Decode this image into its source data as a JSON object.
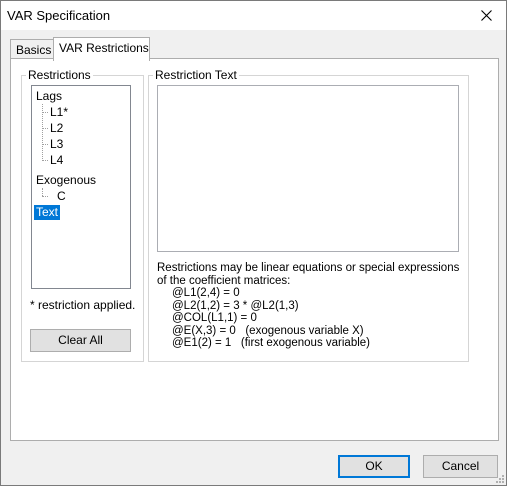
{
  "window": {
    "title": "VAR Specification"
  },
  "tabs": [
    {
      "label": "Basics",
      "active": false
    },
    {
      "label": "VAR Restrictions",
      "active": true
    }
  ],
  "restrictions": {
    "legend": "Restrictions",
    "tree": {
      "lags": {
        "label": "Lags",
        "children": [
          "L1*",
          "L2",
          "L3",
          "L4"
        ]
      },
      "exogenous": {
        "label": "Exogenous",
        "children": [
          "C"
        ]
      },
      "text": {
        "label": "Text",
        "selected": true
      }
    },
    "note": "* restriction applied.",
    "clear_label": "Clear All"
  },
  "restriction_text": {
    "legend": "Restriction Text",
    "value": "",
    "help_intro": [
      "Restrictions may be linear equations or special expressions",
      "of the coefficient matrices:"
    ],
    "examples": [
      "@L1(2,4) = 0",
      "@L2(1,2) = 3 * @L2(1,3)",
      "@COL(L1,1) = 0",
      "@E(X,3) = 0   (exogenous variable X)",
      "@E1(2) = 1   (first exogenous variable)"
    ]
  },
  "footer": {
    "ok_label": "OK",
    "cancel_label": "Cancel"
  },
  "colors": {
    "accent": "#0078d7",
    "selection": "#0078d7"
  }
}
